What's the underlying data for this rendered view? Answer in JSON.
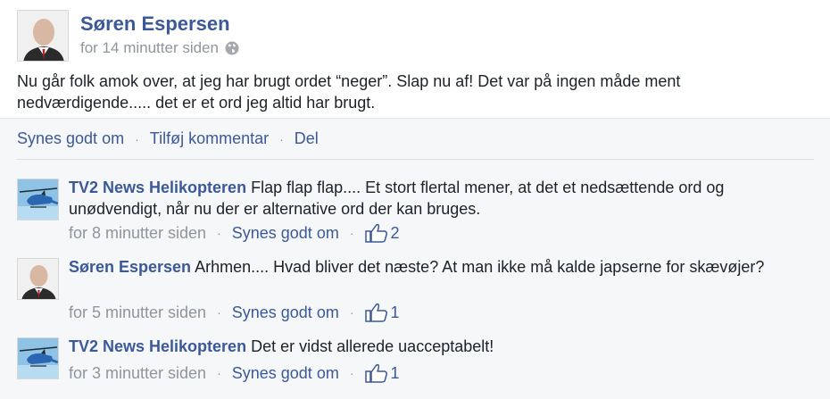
{
  "post": {
    "author": "Søren Espersen",
    "timestamp": "for 14 minutter siden",
    "text": "Nu går folk amok over, at jeg har brugt ordet “neger”. Slap nu af! Det var på ingen måde ment nedværdigende..... det er et ord jeg altid har brugt.",
    "privacy_icon": "globe-icon"
  },
  "actions": {
    "like": "Synes godt om",
    "comment": "Tilføj kommentar",
    "share": "Del",
    "separator": "·"
  },
  "comments": [
    {
      "author": "TV2 News Helikopteren",
      "text": "Flap flap flap....  Et stort flertal mener, at det et nedsættende ord og unødvendigt, når nu der er alternative ord der kan bruges.",
      "timestamp": "for 8 minutter siden",
      "like_label": "Synes godt om",
      "like_count": "2"
    },
    {
      "author": "Søren Espersen",
      "text": "Arhmen.... Hvad bliver det næste? At man ikke må kalde japserne for skævøjer?",
      "timestamp": "for 5 minutter siden",
      "like_label": "Synes godt om",
      "like_count": "1"
    },
    {
      "author": "TV2 News Helikopteren",
      "text": "Det er vidst allerede uacceptabelt!",
      "timestamp": "for 3 minutter siden",
      "like_label": "Synes godt om",
      "like_count": "1"
    }
  ],
  "colors": {
    "link_blue": "#3b5998",
    "meta_gray": "#90949c",
    "feedback_bg": "#f6f7f9"
  }
}
